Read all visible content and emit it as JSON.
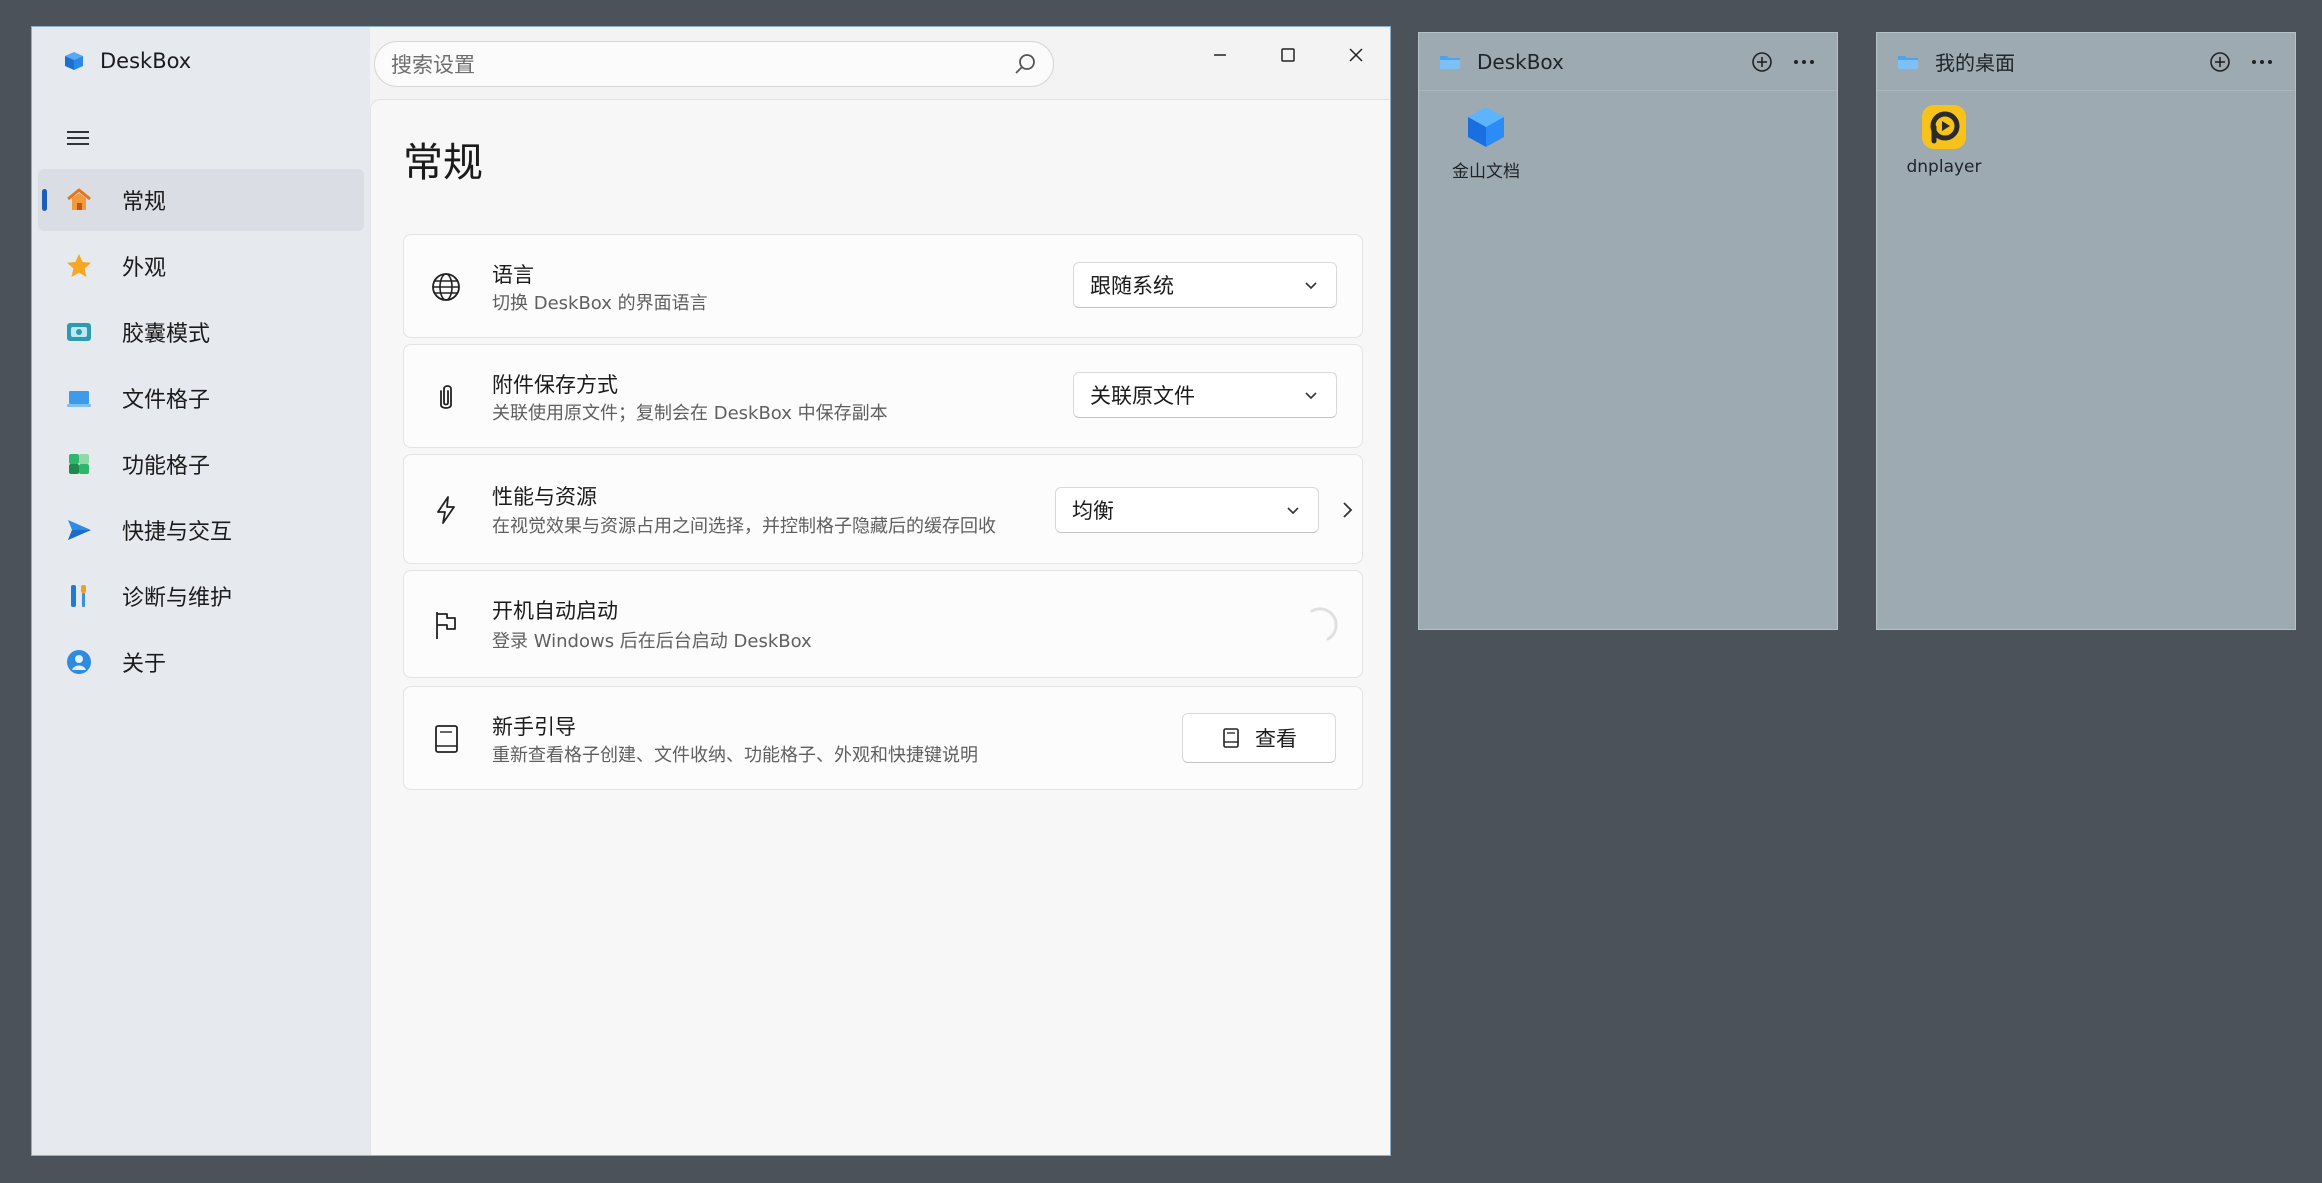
{
  "app": {
    "name": "DeskBox",
    "colors": {
      "accent": "#1a5fb4",
      "sidebar_bg": "#e6e9ed",
      "desktop_bg": "#4b525a",
      "panel_bg": "#9eaab2"
    }
  },
  "search": {
    "placeholder": "搜索设置"
  },
  "window_controls": [
    "minimize-icon",
    "maximize-icon",
    "close-icon"
  ],
  "sidebar": {
    "items": [
      {
        "label": "常规",
        "icon": "home-icon",
        "active": true
      },
      {
        "label": "外观",
        "icon": "star-icon"
      },
      {
        "label": "胶囊模式",
        "icon": "capsule-icon"
      },
      {
        "label": "文件格子",
        "icon": "laptop-icon"
      },
      {
        "label": "功能格子",
        "icon": "grid-icon"
      },
      {
        "label": "快捷与交互",
        "icon": "send-icon"
      },
      {
        "label": "诊断与维护",
        "icon": "tools-icon"
      },
      {
        "label": "关于",
        "icon": "info-icon"
      }
    ]
  },
  "page": {
    "title": "常规",
    "settings": [
      {
        "title": "语言",
        "description": "切换 DeskBox 的界面语言",
        "icon": "globe-icon",
        "control": "dropdown",
        "value": "跟随系统"
      },
      {
        "title": "附件保存方式",
        "description": "关联使用原文件；复制会在 DeskBox 中保存副本",
        "icon": "paperclip-icon",
        "control": "dropdown",
        "value": "关联原文件"
      },
      {
        "title": "性能与资源",
        "description": "在视觉效果与资源占用之间选择，并控制格子隐藏后的缓存回收",
        "icon": "lightning-icon",
        "control": "dropdown",
        "value": "均衡"
      },
      {
        "title": "开机自动启动",
        "description": "登录 Windows 后在后台启动 DeskBox",
        "icon": "flag-icon",
        "control": "toggle"
      },
      {
        "title": "新手引导",
        "description": "重新查看格子创建、文件收纳、功能格子、外观和快捷键说明",
        "icon": "book-icon",
        "control": "button",
        "button_label": "查看"
      }
    ]
  },
  "panels": [
    {
      "title": "DeskBox",
      "items": [
        {
          "label": "金山文档",
          "icon": "kdocs-icon"
        }
      ]
    },
    {
      "title": "我的桌面",
      "items": [
        {
          "label": "dnplayer",
          "icon": "dnplayer-icon"
        }
      ]
    }
  ]
}
